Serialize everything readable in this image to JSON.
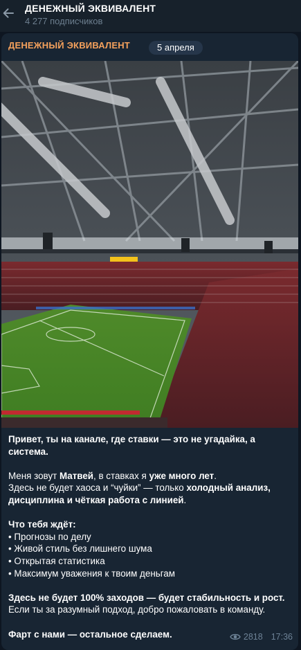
{
  "header": {
    "title": "ДЕНЕЖНЫЙ ЭКВИВАЛЕНТ",
    "subscribers": "4 277 подписчиков",
    "back_icon": "arrow-left-icon"
  },
  "post": {
    "channel_name": "ДЕНЕЖНЫЙ ЭКВИВАЛЕНТ",
    "date": "5 апреля",
    "image_description_icon": "stadium-photo",
    "intro": "Привет, ты на канале, где ставки — это не угадайка, а система.",
    "p2_a": "Меня зовут ",
    "p2_name": "Матвей",
    "p2_b": ", в ставках я ",
    "p2_exp": "уже много лет",
    "p2_c": ".",
    "p3_a": "Здесь не будет хаоса и “чуйки” — только ",
    "p3_bold": "холодный анализ, дисциплина и чёткая работа с линией",
    "p3_c": ".",
    "list_title": "Что тебя ждёт:",
    "list": [
      "• Прогнозы по делу",
      "• Живой стиль без лишнего шума",
      "• Открытая статистика",
      "• Максимум уважения к твоим деньгам"
    ],
    "p5_bold": "Здесь не будет 100% заходов — будет стабильность и рост.",
    "p5_rest": "Если ты за разумный подход, добро пожаловать в команду.",
    "closing": "Фарт с нами — остальное сделаем.",
    "views": "2818",
    "time": "17:36",
    "views_icon": "eye-icon"
  },
  "colors": {
    "background": "#0e1621",
    "header": "#17212b",
    "bubble": "#182533",
    "accent_name": "#f5a15c",
    "muted": "#6d7f8f"
  }
}
